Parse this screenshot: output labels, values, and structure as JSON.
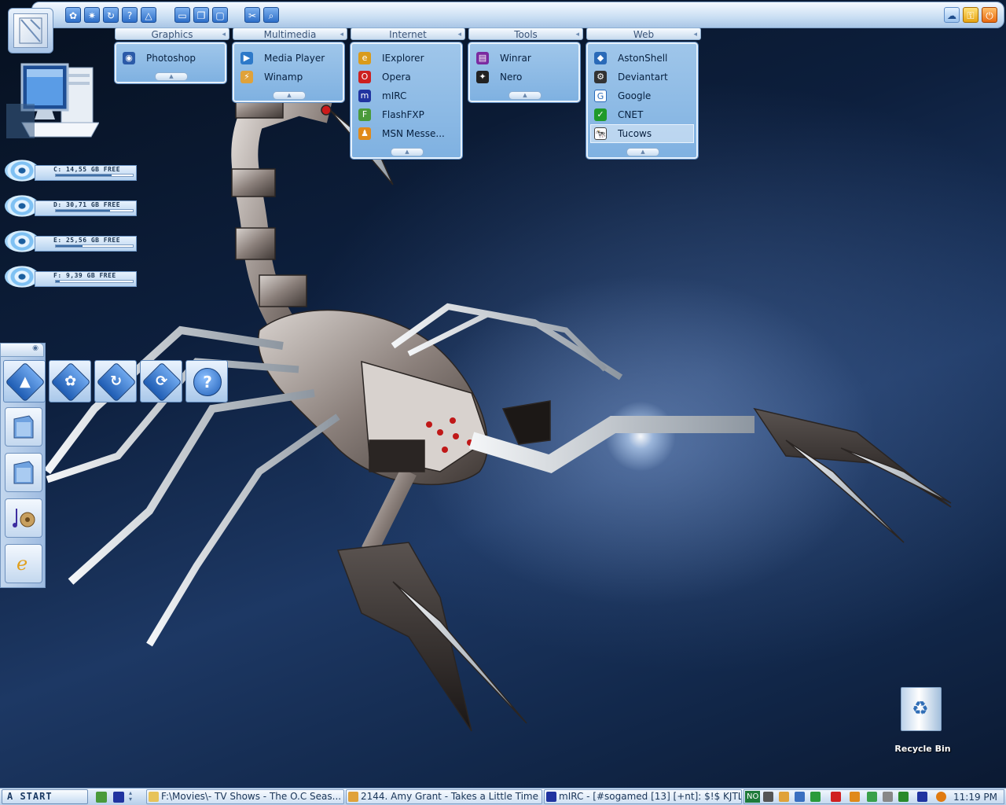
{
  "toolbar": {
    "left_icons": [
      "settings-icon",
      "sparkle-icon",
      "refresh-icon",
      "help-icon",
      "aston-icon"
    ],
    "mid_icons": [
      "window-icon",
      "windows-icon",
      "monitor-icon"
    ],
    "right_icons": [
      "tools-icon",
      "search-icon"
    ],
    "end_icons": [
      "cloud-icon",
      "key-icon",
      "power-icon"
    ]
  },
  "menus": [
    {
      "title": "Graphics",
      "items": [
        {
          "label": "Photoshop",
          "icon": "photoshop-icon",
          "color": "#2b5aa8"
        }
      ]
    },
    {
      "title": "Multimedia",
      "items": [
        {
          "label": "Media Player",
          "icon": "media-player-icon",
          "color": "#2d79c9"
        },
        {
          "label": "Winamp",
          "icon": "winamp-icon",
          "color": "#e0a23a"
        }
      ]
    },
    {
      "title": "Internet",
      "items": [
        {
          "label": "IExplorer",
          "icon": "iexplorer-icon",
          "color": "#d99b1c"
        },
        {
          "label": "Opera",
          "icon": "opera-icon",
          "color": "#cc2020"
        },
        {
          "label": "mIRC",
          "icon": "mirc-icon",
          "color": "#2033a0"
        },
        {
          "label": "FlashFXP",
          "icon": "flashfxp-icon",
          "color": "#4a9a3a"
        },
        {
          "label": "MSN Messe...",
          "icon": "msn-icon",
          "color": "#e08a1a"
        }
      ]
    },
    {
      "title": "Tools",
      "items": [
        {
          "label": "Winrar",
          "icon": "winrar-icon",
          "color": "#7a2aa0"
        },
        {
          "label": "Nero",
          "icon": "nero-icon",
          "color": "#222222"
        }
      ]
    },
    {
      "title": "Web",
      "items": [
        {
          "label": "AstonShell",
          "icon": "astonshell-icon",
          "color": "#2a6ab8"
        },
        {
          "label": "Deviantart",
          "icon": "deviantart-icon",
          "color": "#333333"
        },
        {
          "label": "Google",
          "icon": "google-icon",
          "color": "#2a6ab8"
        },
        {
          "label": "CNET",
          "icon": "cnet-icon",
          "color": "#1f9a2a"
        },
        {
          "label": "Tucows",
          "icon": "tucows-icon",
          "color": "#444444"
        }
      ]
    }
  ],
  "drives": [
    {
      "label": "C: 14,55 GB FREE",
      "free_fraction": 0.72
    },
    {
      "label": "D: 30,71 GB FREE",
      "free_fraction": 0.7
    },
    {
      "label": "E: 25,56 GB FREE",
      "free_fraction": 0.35
    },
    {
      "label": "F: 9,39 GB FREE",
      "free_fraction": 0.05
    }
  ],
  "dock": {
    "horizontal_buttons": [
      "astonshell-icon",
      "settings-icon",
      "refresh-icon",
      "sync-icon",
      "help-icon"
    ],
    "vertical_buttons": [
      "folder-icon",
      "folder-icon",
      "music-icon",
      "internet-explorer-icon"
    ],
    "help_glyph": "?"
  },
  "desktop": {
    "recycle_bin_label": "Recycle Bin"
  },
  "taskbar": {
    "start_label": "A START",
    "tasks": [
      {
        "label": "F:\\Movies\\- TV Shows - The O.C Seas...",
        "icon": "folder-icon",
        "color": "#e7c35a"
      },
      {
        "label": "2144. Amy Grant - Takes a Little Time ...",
        "icon": "winamp-icon",
        "color": "#e0a23a"
      },
      {
        "label": "mIRC - [#sogamed [13] [+nt]: $!$ KJTL...",
        "icon": "mirc-icon",
        "color": "#2033a0"
      }
    ],
    "tray_text": "NO",
    "clock": "11:19 PM"
  }
}
